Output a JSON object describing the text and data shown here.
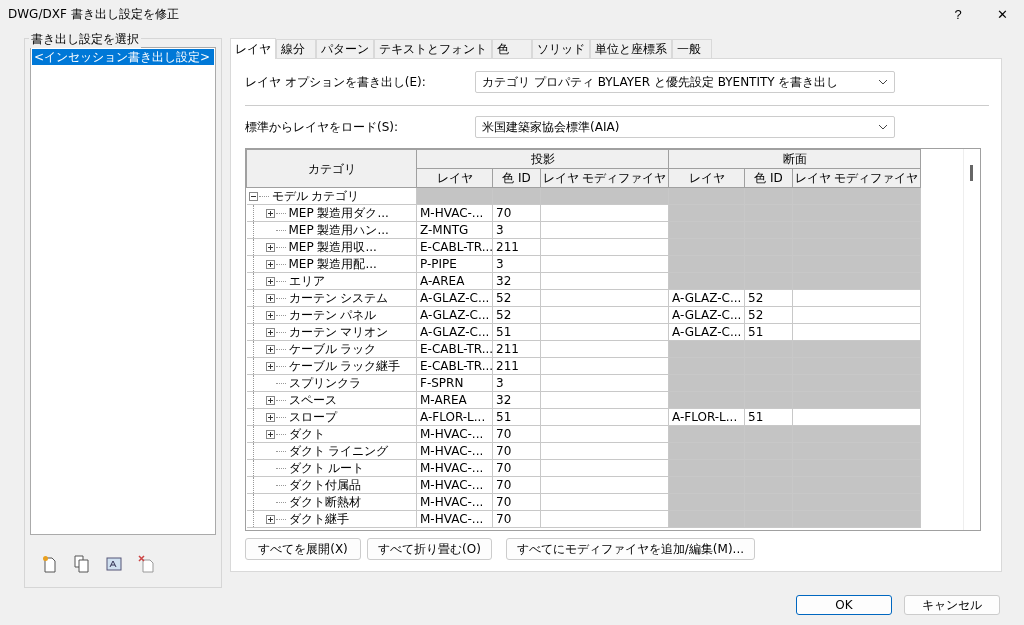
{
  "window": {
    "title": "DWG/DXF 書き出し設定を修正",
    "help": "?",
    "close": "✕"
  },
  "setup_panel": {
    "label": "書き出し設定を選択",
    "items": [
      {
        "label": "<インセッション書き出し設定>",
        "selected": true
      }
    ]
  },
  "tabs": [
    {
      "label": "レイヤ",
      "selected": true
    },
    {
      "label": "線分",
      "selected": false
    },
    {
      "label": "パターン",
      "selected": false
    },
    {
      "label": "テキストとフォント",
      "selected": false
    },
    {
      "label": "色",
      "selected": false
    },
    {
      "label": "ソリッド",
      "selected": false
    },
    {
      "label": "単位と座標系",
      "selected": false
    },
    {
      "label": "一般",
      "selected": false
    }
  ],
  "layer_options": {
    "label": "レイヤ オプションを書き出し(E):",
    "value": "カテゴリ プロパティ BYLAYER と優先設定 BYENTITY を書き出し"
  },
  "load_standard": {
    "label": "標準からレイヤをロード(S):",
    "value": "米国建築家協会標準(AIA)"
  },
  "table": {
    "category_header": "カテゴリ",
    "projection_header": "投影",
    "section_header": "断面",
    "sub_headers": [
      "レイヤ",
      "色 ID",
      "レイヤ モディファイヤ",
      "レイヤ",
      "色 ID",
      "レイヤ モディファイヤ"
    ],
    "rows": [
      {
        "name": "モデル カテゴリ",
        "kind": "group",
        "expanded": true,
        "children": [
          {
            "name": "MEP 製造用ダク...",
            "expandable": true,
            "layer": "M-HVAC-...",
            "color_id": "70"
          },
          {
            "name": "MEP 製造用ハン...",
            "expandable": false,
            "layer": "Z-MNTG",
            "color_id": "3"
          },
          {
            "name": "MEP 製造用収...",
            "expandable": true,
            "layer": "E-CABL-TR...",
            "color_id": "211"
          },
          {
            "name": "MEP 製造用配...",
            "expandable": true,
            "layer": "P-PIPE",
            "color_id": "3"
          },
          {
            "name": "エリア",
            "expandable": true,
            "layer": "A-AREA",
            "color_id": "32"
          },
          {
            "name": "カーテン システム",
            "expandable": true,
            "layer": "A-GLAZ-C...",
            "color_id": "52",
            "section": {
              "layer": "A-GLAZ-C...",
              "color_id": "52"
            }
          },
          {
            "name": "カーテン パネル",
            "expandable": true,
            "layer": "A-GLAZ-C...",
            "color_id": "52",
            "section": {
              "layer": "A-GLAZ-C...",
              "color_id": "52"
            }
          },
          {
            "name": "カーテン マリオン",
            "expandable": true,
            "layer": "A-GLAZ-C...",
            "color_id": "51",
            "section": {
              "layer": "A-GLAZ-C...",
              "color_id": "51"
            }
          },
          {
            "name": "ケーブル ラック",
            "expandable": true,
            "layer": "E-CABL-TR...",
            "color_id": "211"
          },
          {
            "name": "ケーブル ラック継手",
            "expandable": true,
            "layer": "E-CABL-TR...",
            "color_id": "211"
          },
          {
            "name": "スプリンクラ",
            "expandable": false,
            "layer": "F-SPRN",
            "color_id": "3"
          },
          {
            "name": "スペース",
            "expandable": true,
            "layer": "M-AREA",
            "color_id": "32"
          },
          {
            "name": "スロープ",
            "expandable": true,
            "layer": "A-FLOR-L...",
            "color_id": "51",
            "section": {
              "layer": "A-FLOR-L...",
              "color_id": "51"
            }
          },
          {
            "name": "ダクト",
            "expandable": true,
            "layer": "M-HVAC-...",
            "color_id": "70"
          },
          {
            "name": "ダクト ライニング",
            "expandable": false,
            "layer": "M-HVAC-...",
            "color_id": "70"
          },
          {
            "name": "ダクト ルート",
            "expandable": false,
            "layer": "M-HVAC-...",
            "color_id": "70"
          },
          {
            "name": "ダクト付属品",
            "expandable": false,
            "layer": "M-HVAC-...",
            "color_id": "70"
          },
          {
            "name": "ダクト断熱材",
            "expandable": false,
            "layer": "M-HVAC-...",
            "color_id": "70"
          },
          {
            "name": "ダクト継手",
            "expandable": true,
            "layer": "M-HVAC-...",
            "color_id": "70"
          }
        ]
      }
    ]
  },
  "table_buttons": [
    "すべてを展開(X)",
    "すべて折り畳む(O)",
    "すべてにモディファイヤを追加/編集(M)..."
  ],
  "dialog_buttons": [
    {
      "label": "OK",
      "kind": "primary"
    },
    {
      "label": "キャンセル",
      "kind": "normal"
    }
  ]
}
